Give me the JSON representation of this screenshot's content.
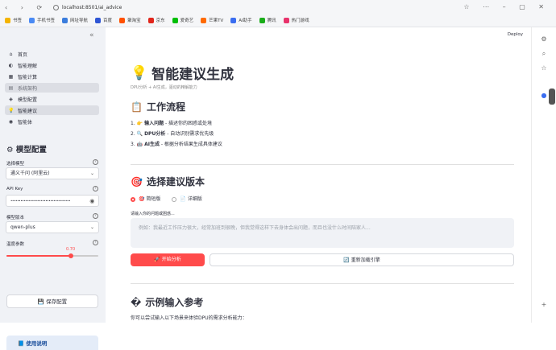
{
  "browser": {
    "url": "localhost:8501/ai_advice",
    "bookmarks": [
      {
        "label": "书签",
        "color": "#f4b400"
      },
      {
        "label": "手机书签",
        "color": "#4a8af4"
      },
      {
        "label": "网址导航",
        "color": "#3b7ddd"
      },
      {
        "label": "百度",
        "color": "#2f55d4"
      },
      {
        "label": "聚淘宝",
        "color": "#ff5000"
      },
      {
        "label": "京东",
        "color": "#e1251b"
      },
      {
        "label": "爱奇艺",
        "color": "#00be06"
      },
      {
        "label": "芒果TV",
        "color": "#ff6a00"
      },
      {
        "label": "AI助手",
        "color": "#3a6df0"
      },
      {
        "label": "腾讯",
        "color": "#1aad19"
      },
      {
        "label": "热门游戏",
        "color": "#e8326b"
      }
    ]
  },
  "sidebar": {
    "nav": [
      {
        "label": "首页",
        "icon": "home-icon"
      },
      {
        "label": "智能理解",
        "icon": "brain-icon"
      },
      {
        "label": "智能计算",
        "icon": "calc-icon"
      },
      {
        "label": "系统架构",
        "icon": "arch-icon"
      },
      {
        "label": "模型配置",
        "icon": "model-icon"
      },
      {
        "label": "智能建议",
        "icon": "bulb-icon"
      },
      {
        "label": "智能体",
        "icon": "agent-icon"
      }
    ],
    "section_title": "模型配置",
    "model_label": "选择模型",
    "model_value": "通义千问 (阿里云)",
    "api_label": "API Key",
    "api_value": "••••••••••••••••••••••••••••••••••••",
    "version_label": "模型版本",
    "version_value": "qwen-plus",
    "temp_label": "温度参数",
    "temp_value": "0.70",
    "temp_fraction": 0.7,
    "save_label": "保存配置",
    "help_label": "使用说明"
  },
  "main": {
    "deploy": "Deploy",
    "title": "智能建议生成",
    "caption": "DPU分析 + AI生成，驱动的精解能力",
    "workflow_title": "工作流程",
    "steps": [
      {
        "num": "1.",
        "head": "输入问题",
        "rest": " - 描述你的困惑或处境"
      },
      {
        "num": "2.",
        "head": "DPU分析",
        "rest": " - 自动识别需求优先级"
      },
      {
        "num": "3.",
        "head": "AI生成",
        "rest": " - 根据分析结果生成具体建议"
      }
    ],
    "version_title": "选择建议版本",
    "radio_simple": "简短版",
    "radio_detail": "详细版",
    "textarea_label": "请输入你的问题或困惑...",
    "textarea_placeholder": "例如：我最近工作压力很大，经常加班到很晚，但我觉得这样下去身体会出问题，而且也没什么时间陪家人...",
    "start_button": "开始分析",
    "reload_button": "重新加载引擎",
    "examples_title": "示例输入参考",
    "examples_note": "你可以尝试输入以下场景来体验DPU的需求分析能力："
  }
}
